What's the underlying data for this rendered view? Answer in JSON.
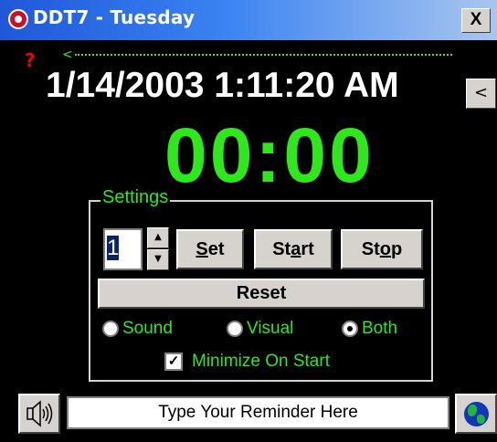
{
  "window": {
    "title": "DDT7 - Tuesday",
    "close_label": "X"
  },
  "help_label": "?",
  "datetime": "1/14/2003 1:11:20 AM",
  "collapse_label": "<",
  "timer_display": "00:00",
  "settings": {
    "legend": "Settings",
    "spin_value": "1",
    "set_label": {
      "pre": "",
      "u": "S",
      "post": "et"
    },
    "start_label": {
      "pre": "St",
      "u": "a",
      "post": "rt"
    },
    "stop_label": {
      "pre": "St",
      "u": "o",
      "post": "p"
    },
    "reset_label": "Reset",
    "alert_options": [
      {
        "label": "Sound",
        "selected": false
      },
      {
        "label": "Visual",
        "selected": false
      },
      {
        "label": "Both",
        "selected": true
      }
    ],
    "minimize_label": "Minimize On Start",
    "minimize_checked": true
  },
  "reminder_placeholder": "Type Your Reminder Here",
  "colors": {
    "accent_green": "#2ee81b",
    "title_blue": "#1f58d8",
    "help_red": "#e00000",
    "background": "#000000"
  },
  "icons": {
    "app": "alarm-clock-icon",
    "speaker": "speaker-icon",
    "globe": "globe-icon"
  }
}
